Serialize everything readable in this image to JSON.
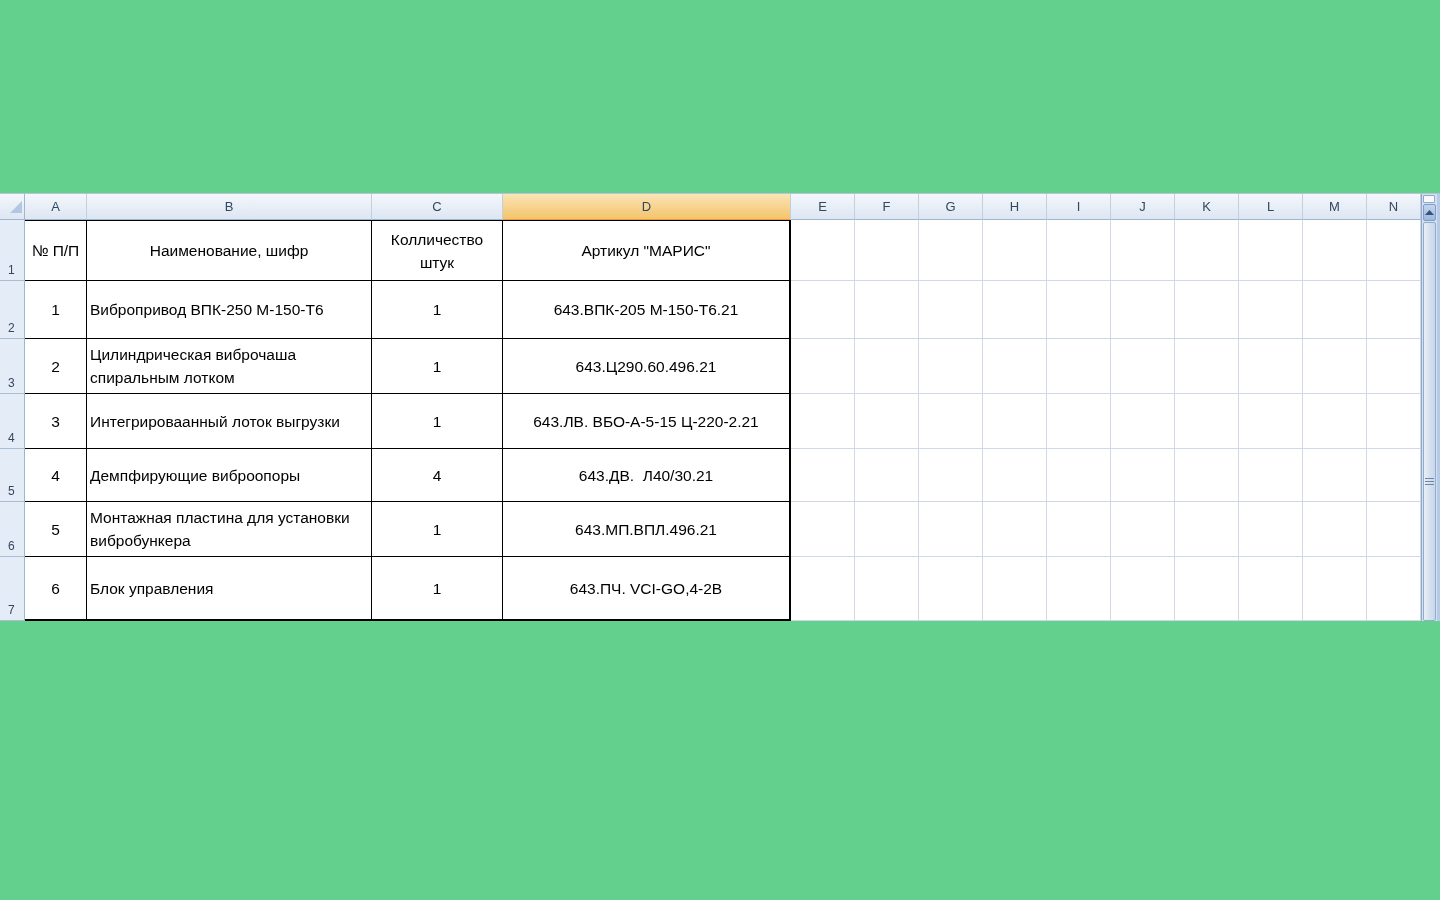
{
  "sheet": {
    "columns": [
      {
        "letter": "A",
        "selected": false
      },
      {
        "letter": "B",
        "selected": false
      },
      {
        "letter": "C",
        "selected": false
      },
      {
        "letter": "D",
        "selected": true
      },
      {
        "letter": "E",
        "selected": false
      },
      {
        "letter": "F",
        "selected": false
      },
      {
        "letter": "G",
        "selected": false
      },
      {
        "letter": "H",
        "selected": false
      },
      {
        "letter": "I",
        "selected": false
      },
      {
        "letter": "J",
        "selected": false
      },
      {
        "letter": "K",
        "selected": false
      },
      {
        "letter": "L",
        "selected": false
      },
      {
        "letter": "M",
        "selected": false
      },
      {
        "letter": "N",
        "selected": false
      }
    ],
    "rows": [
      {
        "number": "1",
        "cells": [
          "№ П/П",
          "Наименование, шифр",
          "Колличество штук",
          "Артикул \"МАРИС\""
        ]
      },
      {
        "number": "2",
        "cells": [
          "1",
          "Вибропривод ВПК-250 М-150-Т6",
          "1",
          "643.ВПК-205 М-150-Т6.21"
        ]
      },
      {
        "number": "3",
        "cells": [
          "2",
          "Цилиндрическая виброчаша спиральным лотком",
          "1",
          "643.Ц290.60.496.21"
        ]
      },
      {
        "number": "4",
        "cells": [
          "3",
          "Интегрироваанный лоток выгрузки",
          "1",
          "643.ЛВ. ВБО-А-5-15 Ц-220-2.21"
        ]
      },
      {
        "number": "5",
        "cells": [
          "4",
          "Демпфирующие виброопоры",
          "4",
          "643.ДВ.  Л40/30.21"
        ]
      },
      {
        "number": "6",
        "cells": [
          "5",
          "Монтажная пластина для установки вибробункера",
          "1",
          "643.МП.ВПЛ.496.21"
        ]
      },
      {
        "number": "7",
        "cells": [
          "6",
          "Блок управления",
          "1",
          "643.ПЧ. VCI-GO,4-2B"
        ]
      }
    ]
  }
}
